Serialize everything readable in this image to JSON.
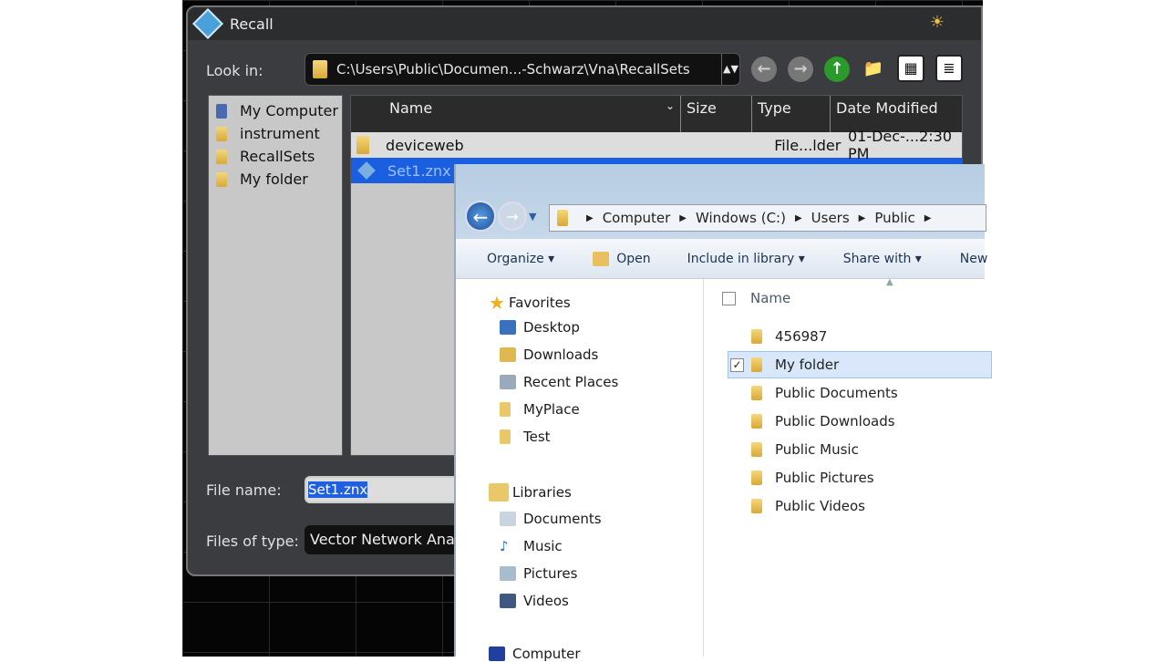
{
  "recall": {
    "title": "Recall",
    "look_in_label": "Look in:",
    "path": "C:\\Users\\Public\\Documen...-Schwarz\\Vna\\RecallSets",
    "places": [
      "My Computer",
      "instrument",
      "RecallSets",
      "My folder"
    ],
    "columns": [
      "Name",
      "Size",
      "Type",
      "Date Modified"
    ],
    "files": [
      {
        "name": "deviceweb",
        "type": "File...lder",
        "date": "01-Dec-...2:30 PM"
      },
      {
        "name": "Set1.znx"
      }
    ],
    "file_name_label": "File name:",
    "file_name": "Set1.znx",
    "files_of_type_label": "Files of type:",
    "files_of_type": "Vector Network Ana"
  },
  "explorer": {
    "breadcrumb": [
      "Computer",
      "Windows (C:)",
      "Users",
      "Public"
    ],
    "toolbar": [
      "Organize ▾",
      "Open",
      "Include in library ▾",
      "Share with ▾",
      "New"
    ],
    "favorites_label": "Favorites",
    "favorites": [
      "Desktop",
      "Downloads",
      "Recent Places",
      "MyPlace",
      "Test"
    ],
    "libraries_label": "Libraries",
    "libraries": [
      "Documents",
      "Music",
      "Pictures",
      "Videos"
    ],
    "computer_label": "Computer",
    "name_header": "Name",
    "items": [
      "456987",
      "My folder",
      "Public Documents",
      "Public Downloads",
      "Public Music",
      "Public Pictures",
      "Public Videos"
    ],
    "selected_item": "My folder"
  }
}
